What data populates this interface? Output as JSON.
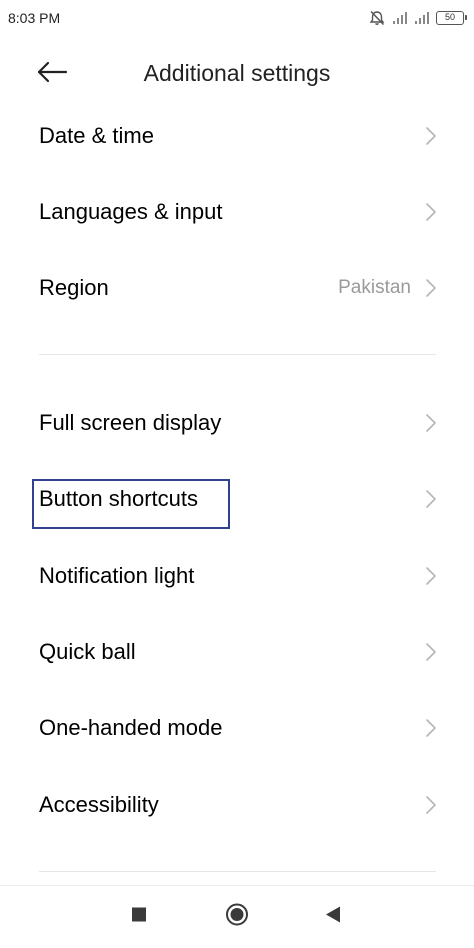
{
  "status_bar": {
    "time": "8:03 PM",
    "battery_level": "50",
    "icons": [
      "alarm-off-icon",
      "signal-icon",
      "signal-icon",
      "battery-icon"
    ]
  },
  "header": {
    "back_icon": "arrow-left-icon",
    "title": "Additional settings"
  },
  "settings": {
    "group1": [
      {
        "label": "Date & time",
        "value": ""
      },
      {
        "label": "Languages & input",
        "value": ""
      },
      {
        "label": "Region",
        "value": "Pakistan"
      }
    ],
    "group2": [
      {
        "label": "Full screen display",
        "value": ""
      },
      {
        "label": "Button shortcuts",
        "value": ""
      },
      {
        "label": "Notification light",
        "value": ""
      },
      {
        "label": "Quick ball",
        "value": ""
      },
      {
        "label": "One-handed mode",
        "value": ""
      },
      {
        "label": "Accessibility",
        "value": ""
      }
    ]
  },
  "highlight": {
    "target": "Button shortcuts",
    "color": "#33408f"
  },
  "nav_bar": {
    "icons": [
      "square-recents-icon",
      "circle-home-icon",
      "triangle-back-icon"
    ]
  }
}
